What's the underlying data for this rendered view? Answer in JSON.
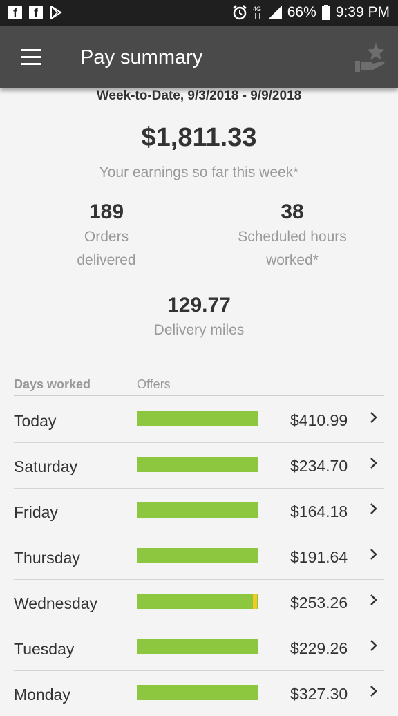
{
  "status_bar": {
    "app_icons": [
      "facebook-icon",
      "facebook-icon",
      "play-store-icon"
    ],
    "battery": "66%",
    "time": "9:39 PM"
  },
  "app_bar": {
    "title": "Pay summary"
  },
  "summary": {
    "period": "Week-to-Date, 9/3/2018 - 9/9/2018",
    "total": "$1,811.33",
    "total_label": "Your earnings so far this week*",
    "orders_value": "189",
    "orders_label_1": "Orders",
    "orders_label_2": "delivered",
    "hours_value": "38",
    "hours_label_1": "Scheduled hours",
    "hours_label_2": "worked*",
    "miles_value": "129.77",
    "miles_label": "Delivery miles"
  },
  "table": {
    "col_days": "Days worked",
    "col_offers": "Offers",
    "rows": [
      {
        "day": "Today",
        "amount": "$410.99"
      },
      {
        "day": "Saturday",
        "amount": "$234.70"
      },
      {
        "day": "Friday",
        "amount": "$164.18"
      },
      {
        "day": "Thursday",
        "amount": "$191.64"
      },
      {
        "day": "Wednesday",
        "amount": "$253.26"
      },
      {
        "day": "Tuesday",
        "amount": "$229.26"
      },
      {
        "day": "Monday",
        "amount": "$327.30"
      }
    ]
  },
  "colors": {
    "offers_bar": "#8dc63f",
    "offers_bar_partial": "#f7c81f",
    "app_bar": "#4a4a4a"
  }
}
